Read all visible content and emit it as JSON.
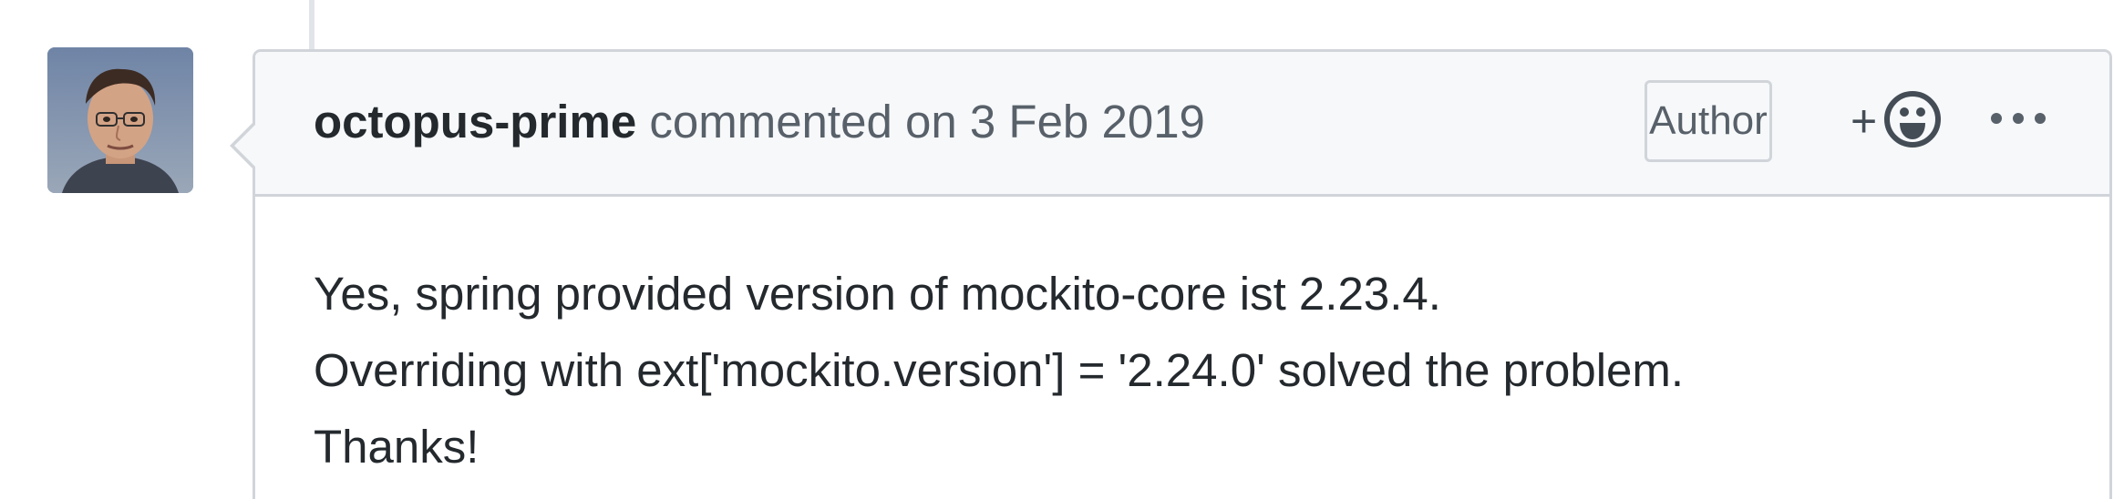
{
  "comment": {
    "author": "octopus-prime",
    "action_text": "commented on 3 Feb 2019",
    "badge": "Author",
    "reaction_plus": "+",
    "icons": {
      "reaction": "smiley-icon",
      "more": "kebab-horizontal-icon"
    },
    "body_lines": [
      "Yes, spring provided version of mockito-core ist 2.23.4.",
      "Overriding with ext['mockito.version'] = '2.24.0' solved the problem.",
      "Thanks!"
    ]
  },
  "colors": {
    "header_bg": "#f6f8fa",
    "border": "#d1d5da",
    "text_primary": "#24292e",
    "text_secondary": "#586069"
  }
}
